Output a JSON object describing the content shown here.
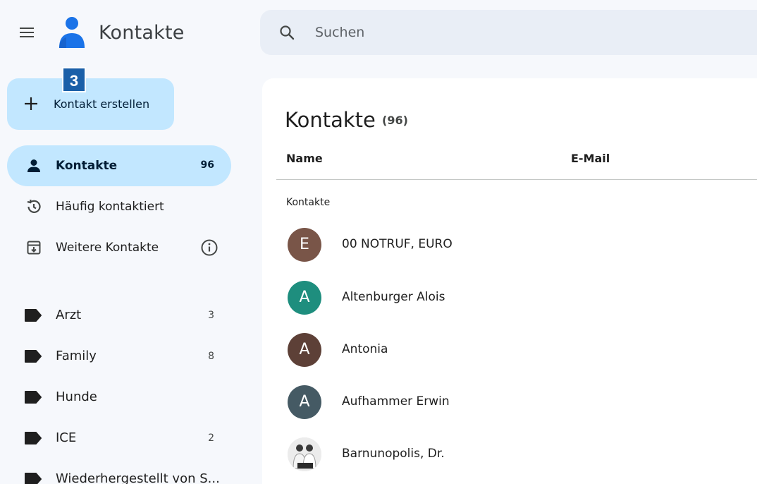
{
  "app": {
    "title": "Kontakte"
  },
  "search": {
    "placeholder": "Suchen",
    "value": ""
  },
  "step_badge": "3",
  "create_button": {
    "label": "Kontakt erstellen"
  },
  "nav": [
    {
      "label": "Kontakte",
      "count": "96",
      "icon": "person-icon",
      "active": true
    },
    {
      "label": "Häufig kontaktiert",
      "count": "",
      "icon": "history-icon",
      "active": false
    },
    {
      "label": "Weitere Kontakte",
      "count": "",
      "icon": "archive-icon",
      "active": false,
      "info_icon": "info-icon"
    }
  ],
  "labels": [
    {
      "name": "Arzt",
      "count": "3",
      "icon": "label-icon"
    },
    {
      "name": "Family",
      "count": "8",
      "icon": "label-icon"
    },
    {
      "name": "Hunde",
      "count": "",
      "icon": "label-icon"
    },
    {
      "name": "ICE",
      "count": "2",
      "icon": "label-icon"
    },
    {
      "name": "Wiederhergestellt von S...",
      "count": "",
      "icon": "label-icon"
    }
  ],
  "main": {
    "title": "Kontakte",
    "count": "(96)",
    "columns": {
      "name": "Name",
      "email": "E-Mail"
    },
    "section_label": "Kontakte",
    "contacts": [
      {
        "initial": "E",
        "name": "00 NOTRUF, EURO",
        "color": "#795548"
      },
      {
        "initial": "A",
        "name": "Altenburger Alois",
        "color": "#1e8e7e"
      },
      {
        "initial": "A",
        "name": "Antonia",
        "color": "#5d4037"
      },
      {
        "initial": "A",
        "name": "Aufhammer Erwin",
        "color": "#455a64"
      },
      {
        "initial": "",
        "name": "Barnunopolis, Dr.",
        "color": "#e6e6e6",
        "photo": true
      }
    ]
  },
  "colors": {
    "accent": "#c2e7ff",
    "background": "#f6f8fc",
    "search_bg": "#e9eef6",
    "badge": "#1a5fa8"
  }
}
